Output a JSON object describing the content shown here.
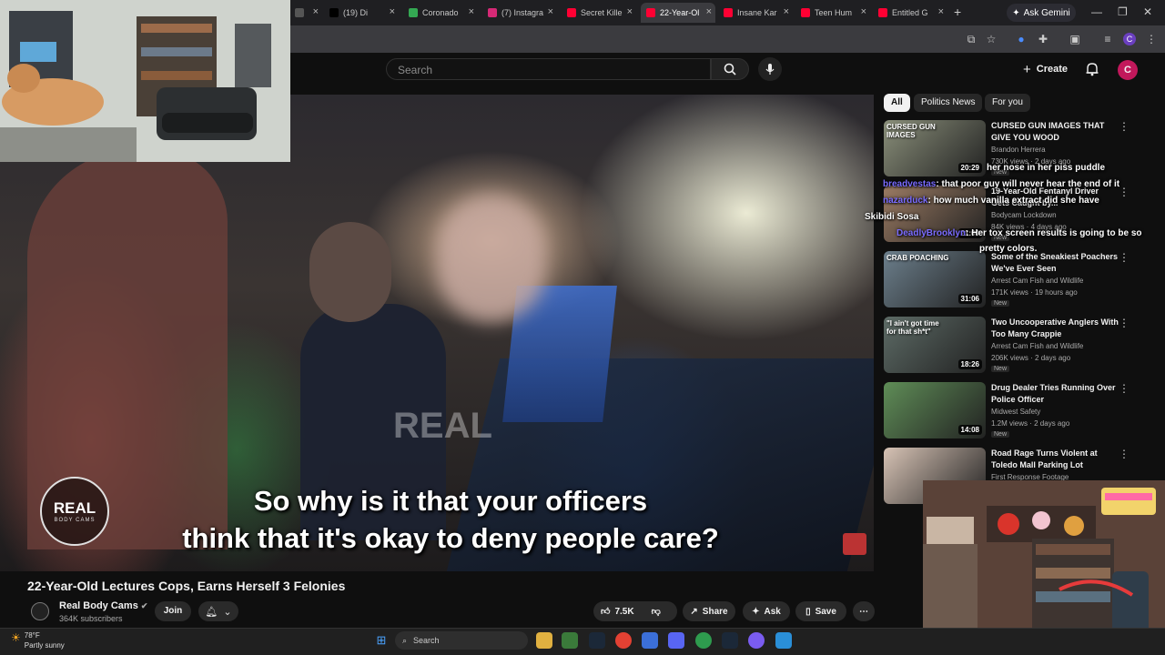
{
  "browser": {
    "tabs": [
      {
        "label": "",
        "favicon": "generic-icon",
        "color": "#555555"
      },
      {
        "label": "(19) Di",
        "favicon": "x-icon",
        "color": "#000000"
      },
      {
        "label": "Coronado",
        "favicon": "maps-pin-icon",
        "color": "#34a853"
      },
      {
        "label": "(7) Instagra",
        "favicon": "instagram-icon",
        "color": "#d62976"
      },
      {
        "label": "Secret Kille",
        "favicon": "youtube-icon",
        "color": "#ff0033"
      },
      {
        "label": "22-Year-Ol",
        "favicon": "youtube-icon",
        "color": "#ff0033",
        "active": true
      },
      {
        "label": "Insane Kar",
        "favicon": "youtube-icon",
        "color": "#ff0033"
      },
      {
        "label": "Teen Hum",
        "favicon": "youtube-icon",
        "color": "#ff0033"
      },
      {
        "label": "Entitled G",
        "favicon": "youtube-icon",
        "color": "#ff0033"
      }
    ],
    "new_tab": "+",
    "ask_gemini": "Ask Gemini",
    "profile_initial": "C"
  },
  "youtube": {
    "search_placeholder": "Search",
    "create_label": "Create",
    "avatar_initial": "C",
    "avatar_color": "#c2185b"
  },
  "video": {
    "caption_line1": "So why is it that your officers",
    "caption_line2": "think that it's okay to deny people care?",
    "watermark": "REAL",
    "logo_line1": "REAL",
    "logo_line2": "BODY CAMS",
    "title": "22-Year-Old Lectures Cops, Earns Herself 3 Felonies",
    "channel": "Real Body Cams",
    "subscribers": "364K subscribers",
    "join_label": "Join",
    "likes": "7.5K",
    "share_label": "Share",
    "ask_label": "Ask",
    "save_label": "Save"
  },
  "sidebar": {
    "chips": [
      "All",
      "Politics News",
      "For you"
    ],
    "videos": [
      {
        "title": "CURSED GUN IMAGES THAT GIVE YOU WOOD",
        "channel": "Brandon Herrera",
        "meta": "730K views · 2 days ago",
        "new": "New",
        "duration": "20:29",
        "thumb_text": "CURSED GUN IMAGES",
        "thumb_color": "#8a8f7a"
      },
      {
        "title": "19-Year-Old Fentanyl Driver Gets Caught by...",
        "channel": "Bodycam Lockdown",
        "meta": "84K views · 4 days ago",
        "new": "New",
        "duration": "21:00",
        "thumb_text": "",
        "thumb_color": "#9b7b63"
      },
      {
        "title": "Some of the Sneakiest Poachers We've Ever Seen",
        "channel": "Arrest Cam Fish and Wildlife",
        "meta": "171K views · 19 hours ago",
        "new": "New",
        "duration": "31:06",
        "thumb_text": "CRAB POACHING",
        "thumb_color": "#6c7f8c"
      },
      {
        "title": "Two Uncooperative Anglers With Too Many Crappie",
        "channel": "Arrest Cam Fish and Wildlife",
        "meta": "206K views · 2 days ago",
        "new": "New",
        "duration": "18:26",
        "thumb_text": "\"I ain't got time for that sh*t\"",
        "thumb_color": "#5d6b66"
      },
      {
        "title": "Drug Dealer Tries Running Over Police Officer",
        "channel": "Midwest Safety",
        "meta": "1.2M views · 2 days ago",
        "new": "New",
        "duration": "14:08",
        "thumb_text": "",
        "thumb_color": "#5f8d57"
      },
      {
        "title": "Road Rage Turns Violent at Toledo Mall Parking Lot",
        "channel": "First Response Footage",
        "meta": "",
        "new": "",
        "duration": "",
        "thumb_text": "",
        "thumb_color": "#d7c3b5"
      }
    ]
  },
  "chat": [
    {
      "user": "",
      "text": "her nose in her piss puddle"
    },
    {
      "user": "breadvestas",
      "text": "that poor guy will never hear the end of it"
    },
    {
      "user": "nazarduck",
      "text": "how much vanilla extract did she have"
    },
    {
      "user": "",
      "text": "Skibidi Sosa"
    },
    {
      "user": "DeadlyBrooklyn",
      "text": "Her tox screen results is going to be so"
    },
    {
      "user": "",
      "text": "pretty colors."
    }
  ],
  "taskbar": {
    "temperature": "78°F",
    "weather": "Partly sunny",
    "search_label": "Search"
  }
}
